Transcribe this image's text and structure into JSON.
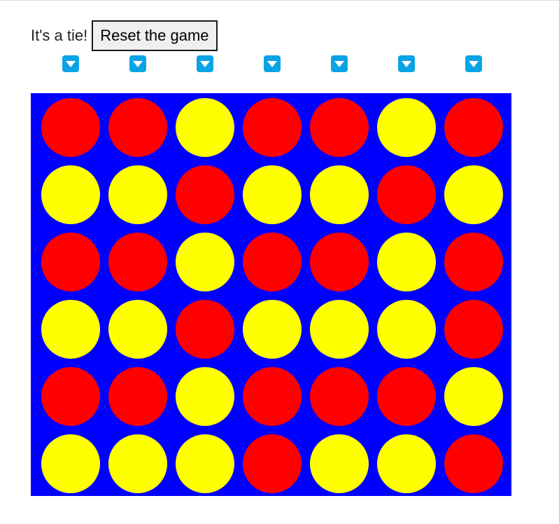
{
  "status": {
    "message": "It's a tie!"
  },
  "controls": {
    "reset_label": "Reset the game"
  },
  "drop_buttons": {
    "count": 7,
    "icon": "chevron-down-icon"
  },
  "colors": {
    "board": "#0000ff",
    "red": "#ff0000",
    "yellow": "#ffff00",
    "empty": "#ffffff",
    "drop_button": "#0aa3e6"
  },
  "board": {
    "rows": 6,
    "columns": 7,
    "cells": [
      [
        "red",
        "red",
        "yellow",
        "red",
        "red",
        "yellow",
        "red"
      ],
      [
        "yellow",
        "yellow",
        "red",
        "yellow",
        "yellow",
        "red",
        "yellow"
      ],
      [
        "red",
        "red",
        "yellow",
        "red",
        "red",
        "yellow",
        "red"
      ],
      [
        "yellow",
        "yellow",
        "red",
        "yellow",
        "yellow",
        "yellow",
        "red"
      ],
      [
        "red",
        "red",
        "yellow",
        "red",
        "red",
        "red",
        "yellow"
      ],
      [
        "yellow",
        "yellow",
        "yellow",
        "red",
        "yellow",
        "yellow",
        "red"
      ]
    ]
  }
}
